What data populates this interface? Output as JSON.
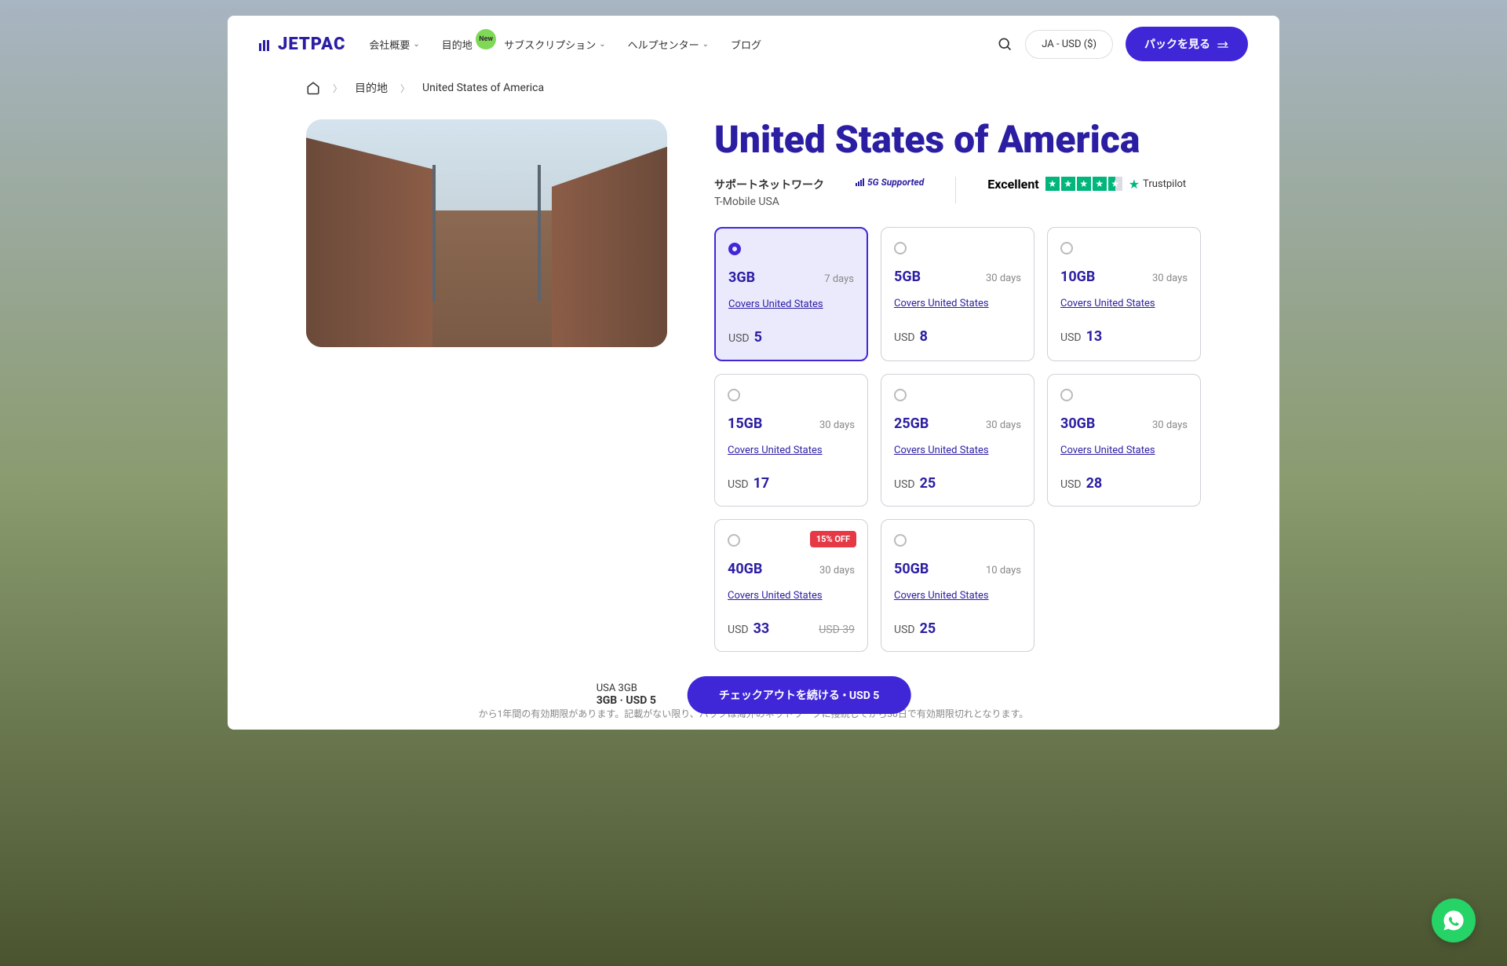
{
  "brand": "JETPAC",
  "nav": {
    "items": [
      {
        "label": "会社概要",
        "hasChevron": true
      },
      {
        "label": "目的地",
        "hasChevron": true,
        "badge": "New"
      },
      {
        "label": "サブスクリプション",
        "hasChevron": true
      },
      {
        "label": "ヘルプセンター",
        "hasChevron": true
      },
      {
        "label": "ブログ",
        "hasChevron": false
      }
    ],
    "locale": "JA - USD ($)",
    "cta": "パックを見る"
  },
  "breadcrumb": {
    "item1": "目的地",
    "item2": "United States of America"
  },
  "page": {
    "title": "United States of America",
    "networkLabel": "サポートネットワーク",
    "networkName": "T-Mobile USA",
    "support5g": "5G Supported",
    "trustpilot": {
      "label": "Excellent",
      "brand": "Trustpilot"
    }
  },
  "plans": [
    {
      "size": "3GB",
      "days": "7 days",
      "covers": "Covers United States",
      "currency": "USD",
      "price": "5",
      "selected": true
    },
    {
      "size": "5GB",
      "days": "30 days",
      "covers": "Covers United States",
      "currency": "USD",
      "price": "8"
    },
    {
      "size": "10GB",
      "days": "30 days",
      "covers": "Covers United States",
      "currency": "USD",
      "price": "13"
    },
    {
      "size": "15GB",
      "days": "30 days",
      "covers": "Covers United States",
      "currency": "USD",
      "price": "17"
    },
    {
      "size": "25GB",
      "days": "30 days",
      "covers": "Covers United States",
      "currency": "USD",
      "price": "25"
    },
    {
      "size": "30GB",
      "days": "30 days",
      "covers": "Covers United States",
      "currency": "USD",
      "price": "28"
    },
    {
      "size": "40GB",
      "days": "30 days",
      "covers": "Covers United States",
      "currency": "USD",
      "price": "33",
      "oldPrice": "USD 39",
      "discount": "15% OFF"
    },
    {
      "size": "50GB",
      "days": "10 days",
      "covers": "Covers United States",
      "currency": "USD",
      "price": "25"
    }
  ],
  "disclaimer": "から1年間の有効期限があります。記載がない限り、パックは海外のネットワークに接続してから30日で有効期限切れとなります。",
  "checkout": {
    "summary1": "USA 3GB",
    "summary2": "3GB  ·  USD 5",
    "button": "チェックアウトを続ける • USD 5"
  }
}
